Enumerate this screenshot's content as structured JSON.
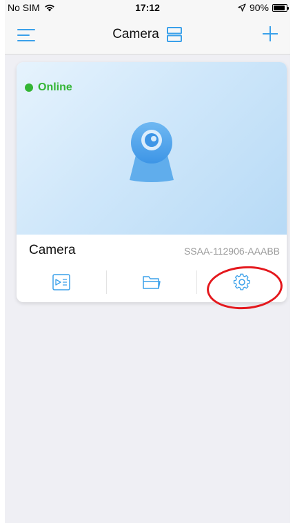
{
  "status_bar": {
    "carrier": "No SIM",
    "time": "17:12",
    "battery_percent": "90%",
    "battery_level": 0.9
  },
  "nav": {
    "title": "Camera",
    "menu_icon": "hamburger-menu-icon",
    "layout_icon": "split-layout-icon",
    "add_icon": "plus-icon"
  },
  "camera_card": {
    "status": "Online",
    "name": "Camera",
    "serial": "SSAA-112906-AAABB",
    "actions": [
      {
        "name": "playback",
        "icon": "video-playback-icon"
      },
      {
        "name": "files",
        "icon": "folder-icon"
      },
      {
        "name": "settings",
        "icon": "gear-icon"
      }
    ]
  },
  "colors": {
    "accent": "#3aa0ea",
    "online": "#34b535",
    "annotation": "#e4181d"
  }
}
